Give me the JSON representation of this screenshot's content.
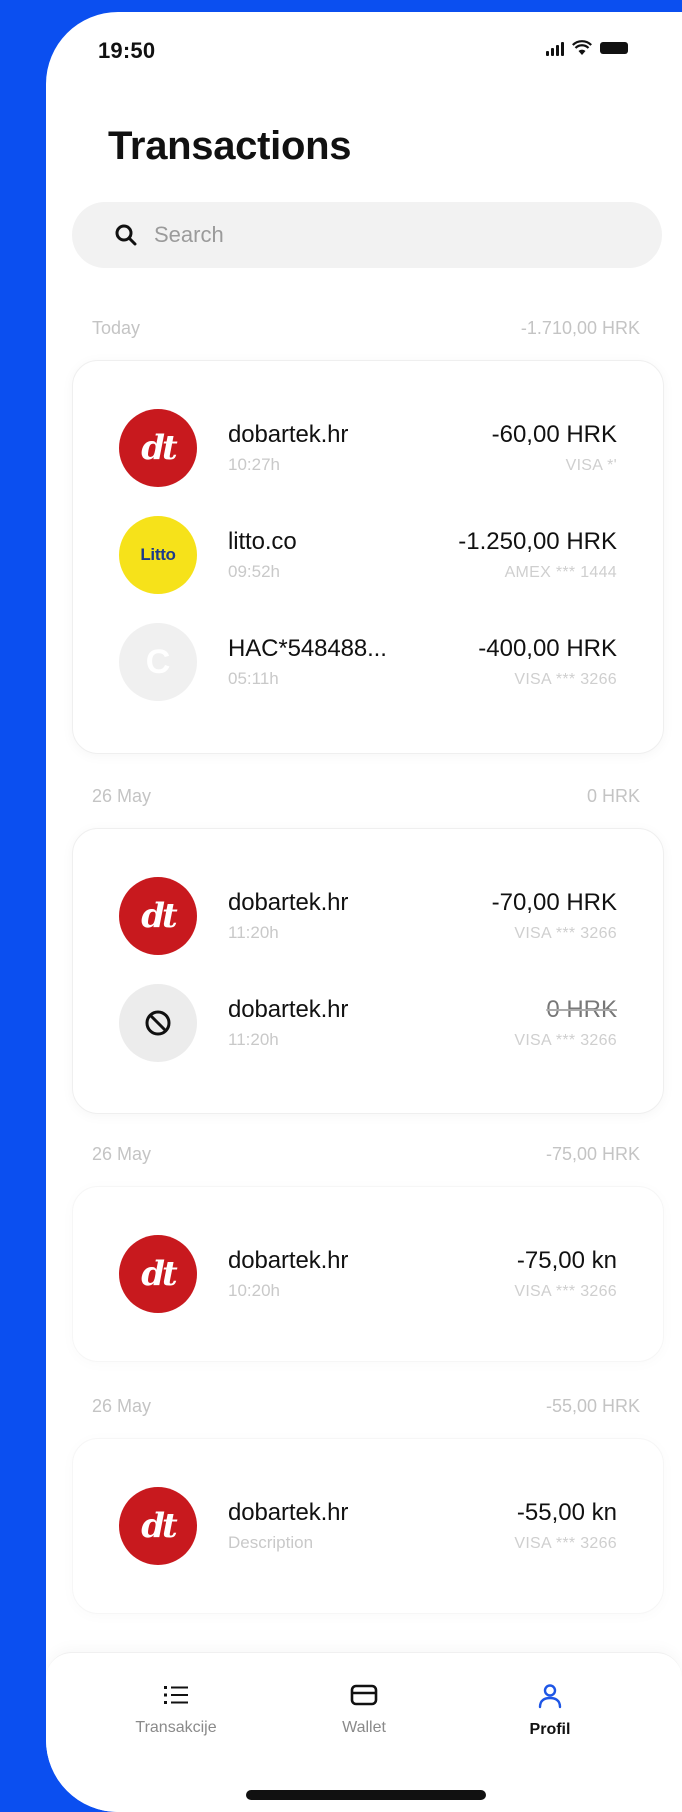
{
  "status": {
    "time": "19:50"
  },
  "page": {
    "title": "Transactions"
  },
  "search": {
    "placeholder": "Search"
  },
  "sections": [
    {
      "label": "Today",
      "total": "-1.710,00 HRK",
      "items": [
        {
          "merchant": "dobartek.hr",
          "time": "10:27h",
          "amount": "-60,00 HRK",
          "card": "VISA *'",
          "logo": "dt"
        },
        {
          "merchant": "litto.co",
          "time": "09:52h",
          "amount": "-1.250,00 HRK",
          "card": "AMEX *** 1444",
          "logo": "Litto"
        },
        {
          "merchant": "HAC*548488...",
          "time": "05:11h",
          "amount": "-400,00 HRK",
          "card": "VISA *** 3266",
          "logo": "C"
        }
      ]
    },
    {
      "label": "26 May",
      "total": "0 HRK",
      "items": [
        {
          "merchant": "dobartek.hr",
          "time": "11:20h",
          "amount": "-70,00 HRK",
          "card": "VISA *** 3266",
          "logo": "dt"
        },
        {
          "merchant": "dobartek.hr",
          "time": "11:20h",
          "amount": "0 HRK",
          "card": "VISA *** 3266",
          "logo": "blocked-icon"
        }
      ]
    },
    {
      "label": "26 May",
      "total": "-75,00 HRK",
      "items": [
        {
          "merchant": "dobartek.hr",
          "time": "10:20h",
          "amount": "-75,00 kn",
          "card": "VISA *** 3266",
          "logo": "dt"
        }
      ]
    },
    {
      "label": "26 May",
      "total": "-55,00 HRK",
      "items": [
        {
          "merchant": "dobartek.hr",
          "time": "Description",
          "amount": "-55,00 kn",
          "card": "VISA *** 3266",
          "logo": "dt"
        }
      ]
    }
  ],
  "tabbar": {
    "tabs": [
      {
        "label": "Transakcije",
        "icon": "list-icon"
      },
      {
        "label": "Wallet",
        "icon": "wallet-icon"
      },
      {
        "label": "Profil",
        "icon": "person-icon",
        "active": true
      }
    ]
  },
  "colors": {
    "background": "#0b4ff0",
    "brand_red": "#c8191e",
    "litto_yellow": "#f6e21a",
    "active_tab": "#1e56e6"
  }
}
